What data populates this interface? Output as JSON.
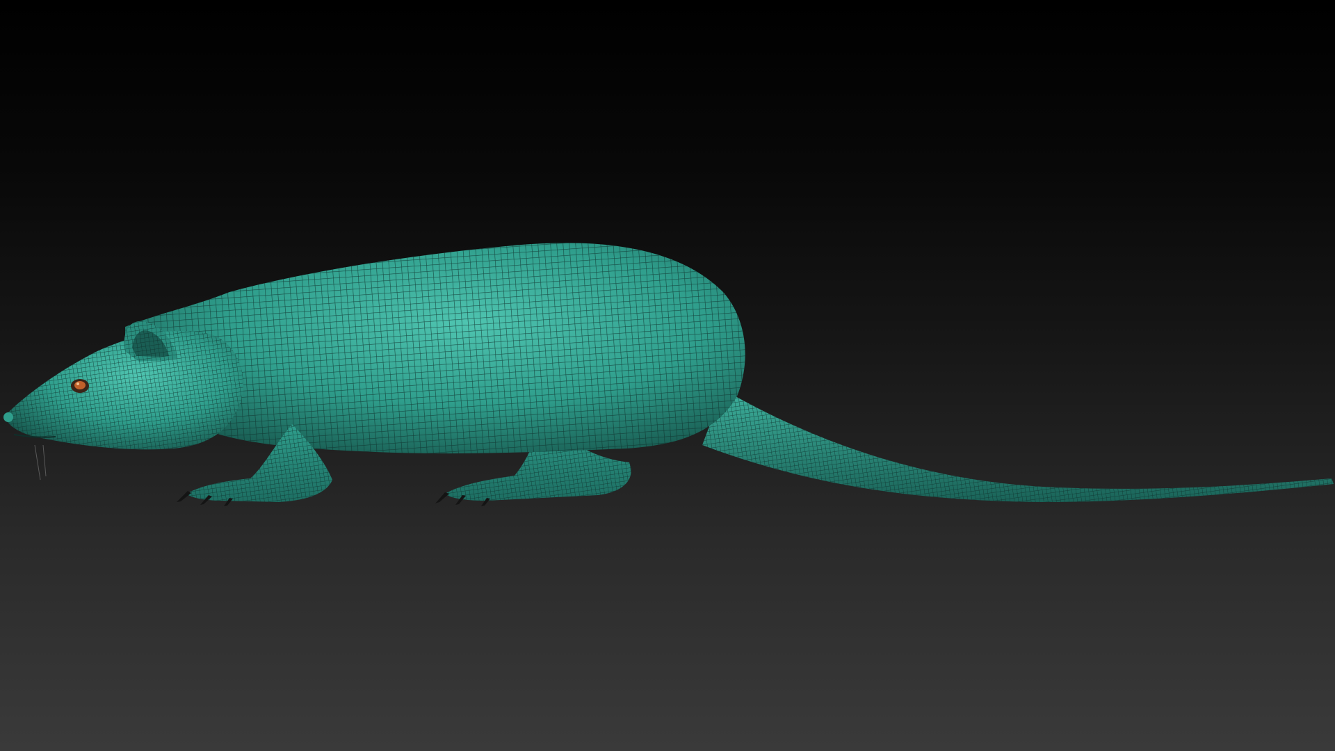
{
  "viewport": {
    "background_top": "#000000",
    "background_bottom": "#3a3a3a"
  },
  "model": {
    "subject": "rat",
    "display_mode": "polyframe-wireframe",
    "material_color": "#2f9e8c",
    "highlight_color": "#4fc4b0",
    "shadow_color": "#17574d",
    "wire_color": "#0f2f2a",
    "eye_color": "#c0602a",
    "claw_color": "#141414"
  }
}
